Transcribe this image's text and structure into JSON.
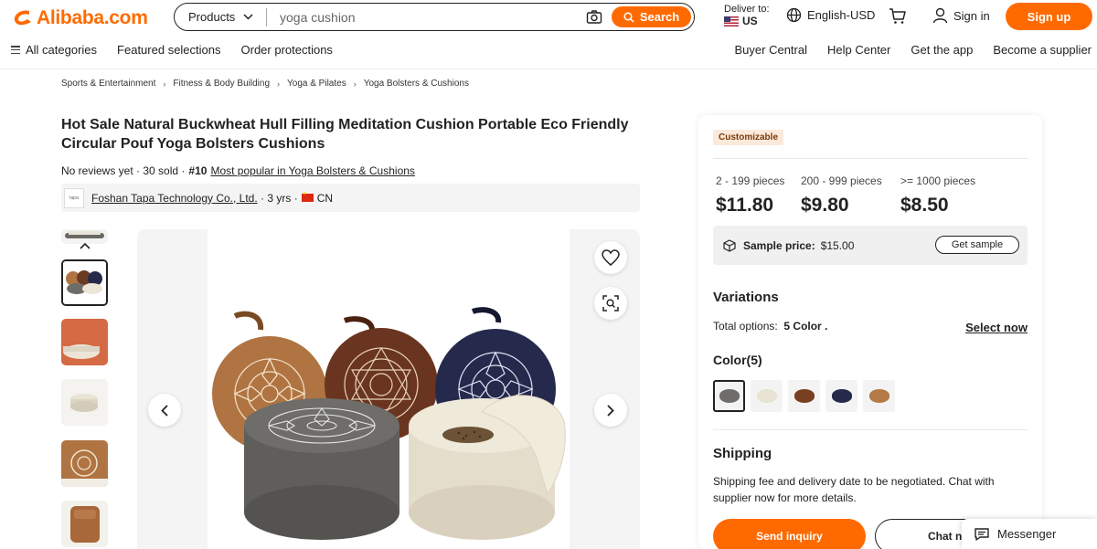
{
  "brand": {
    "name": "Alibaba.com",
    "accent": "#ff6a00"
  },
  "search": {
    "category": "Products",
    "value": "yoga cushion",
    "button": "Search"
  },
  "deliver": {
    "label": "Deliver to:",
    "country": "US"
  },
  "language": "English-USD",
  "account": {
    "sign_in": "Sign in",
    "sign_up": "Sign up"
  },
  "nav": {
    "all_categories": "All categories",
    "featured": "Featured selections",
    "order_protections": "Order protections",
    "right": [
      "Buyer Central",
      "Help Center",
      "Get the app",
      "Become a supplier"
    ]
  },
  "breadcrumb": [
    "Sports & Entertainment",
    "Fitness & Body Building",
    "Yoga & Pilates",
    "Yoga Bolsters & Cushions"
  ],
  "product": {
    "title": "Hot Sale Natural Buckwheat Hull Filling Meditation Cushion Portable Eco Friendly Circular Pouf Yoga Bolsters Cushions",
    "reviews": "No reviews yet",
    "sold": "30 sold",
    "rank": "#10",
    "rank_link": "Most popular in Yoga Bolsters & Cushions",
    "supplier": "Foshan Tapa Technology Co., Ltd.",
    "years": "3 yrs",
    "country": "CN"
  },
  "panel": {
    "badge": "Customizable",
    "tiers": [
      {
        "qty": "2 - 199 pieces",
        "price": "$11.80"
      },
      {
        "qty": "200 - 999 pieces",
        "price": "$9.80"
      },
      {
        "qty": ">= 1000 pieces",
        "price": "$8.50"
      }
    ],
    "sample_label": "Sample price:",
    "sample_price": "$15.00",
    "get_sample": "Get sample",
    "variations_title": "Variations",
    "total_label": "Total options:",
    "total_value": "5 Color",
    "select_now": "Select now",
    "color_label": "Color(5)",
    "swatch_colors": [
      "#6f6d69",
      "#e9e3d3",
      "#7a3f22",
      "#262a4a",
      "#b47a45"
    ],
    "shipping_title": "Shipping",
    "shipping_text": "Shipping fee and delivery date to be negotiated. Chat with supplier now for more details.",
    "send_inquiry": "Send inquiry",
    "chat_now": "Chat now"
  },
  "messenger": "Messenger"
}
